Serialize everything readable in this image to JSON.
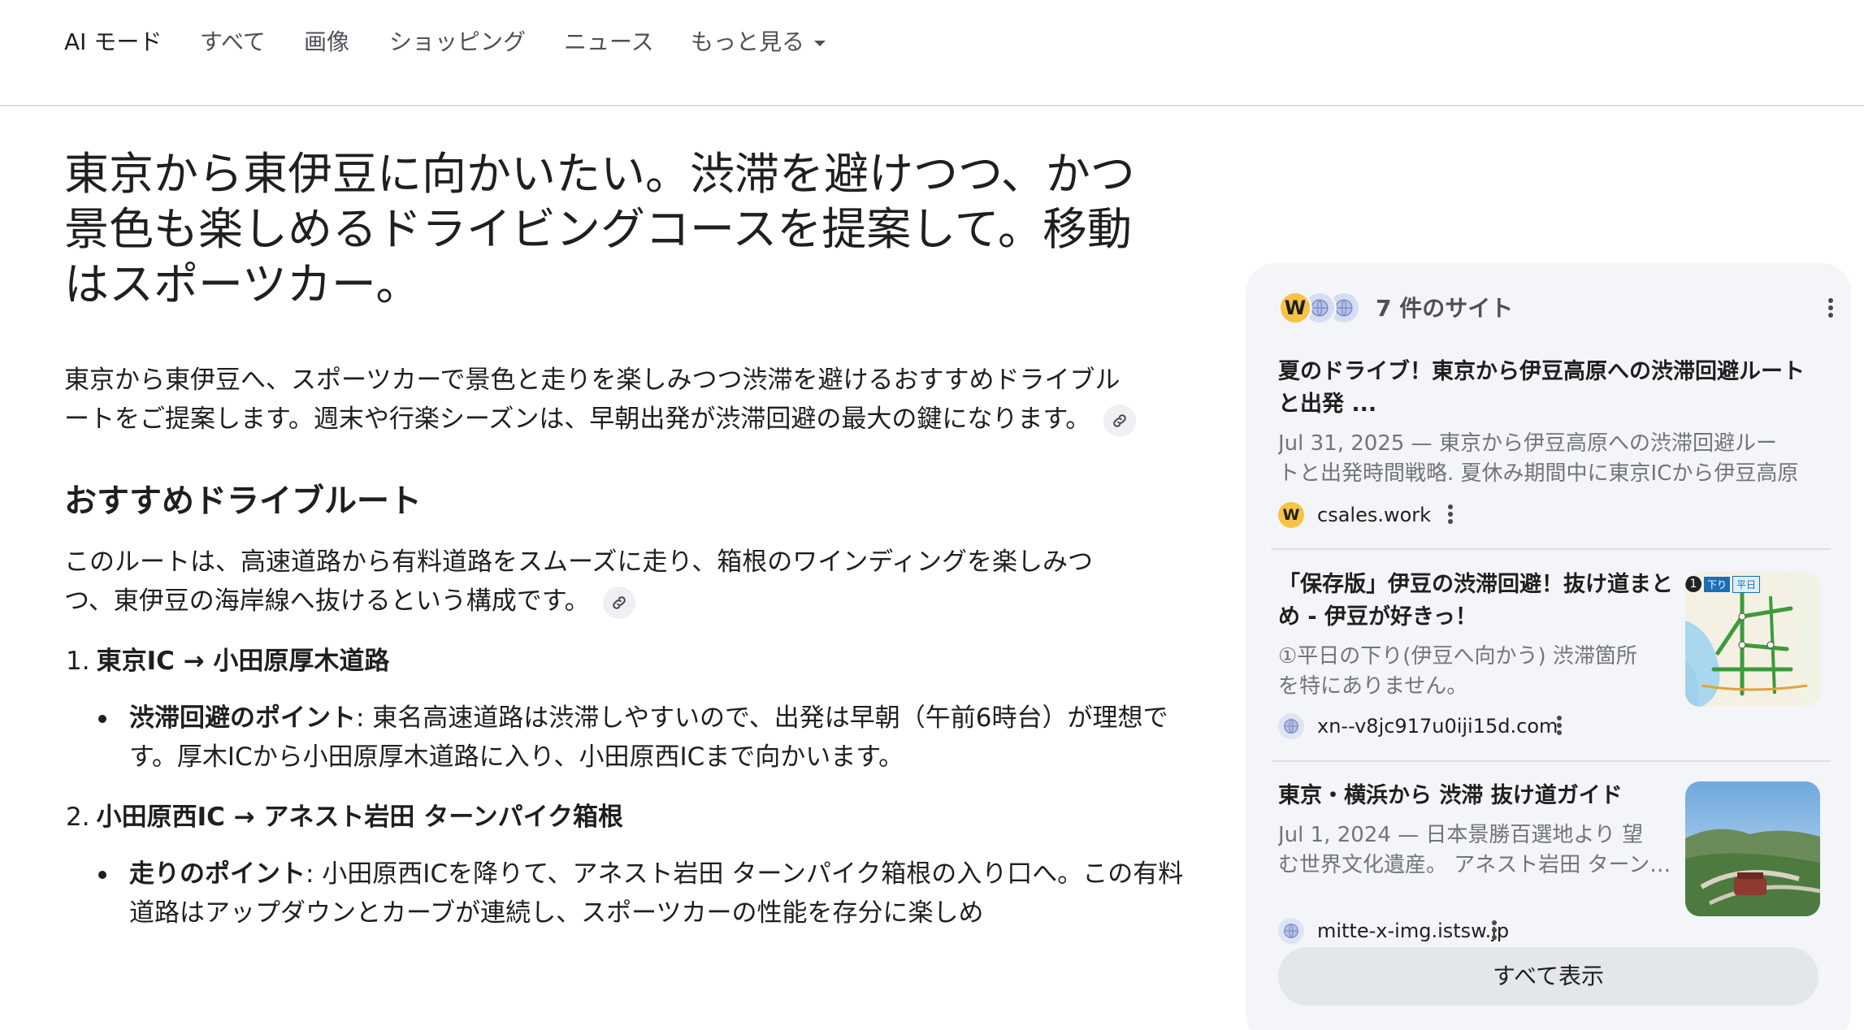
{
  "nav": {
    "items": [
      "AI モード",
      "すべて",
      "画像",
      "ショッピング",
      "ニュース",
      "もっと見る"
    ]
  },
  "main": {
    "query": "東京から東伊豆に向かいたい。渋滞を避けつつ、かつ景色も楽しめるドライビングコースを提案して。移動はスポーツカー。",
    "intro": "東京から東伊豆へ、スポーツカーで景色と走りを楽しみつつ渋滞を避けるおすすめドライブルートをご提案します。週末や行楽シーズンは、早朝出発が渋滞回避の最大の鍵になります。",
    "section_heading": "おすすめドライブルート",
    "section_text": "このルートは、高速道路から有料道路をスムーズに走り、箱根のワインディングを楽しみつつ、東伊豆の海岸線へ抜けるという構成です。",
    "steps": [
      {
        "num": "1.",
        "title": "東京IC → 小田原厚木道路",
        "point_label": "渋滞回避のポイント",
        "point_text": ": 東名高速道路は渋滞しやすいので、出発は早朝（午前6時台）が理想です。厚木ICから小田原厚木道路に入り、小田原西ICまで向かいます。"
      },
      {
        "num": "2.",
        "title": "小田原西IC → アネスト岩田 ターンパイク箱根",
        "point_label": "走りのポイント",
        "point_text": ": 小田原西ICを降りて、アネスト岩田 ターンパイク箱根の入り口へ。この有料道路はアップダウンとカーブが連続し、スポーツカーの性能を存分に楽しめ"
      }
    ]
  },
  "sources": {
    "header": "7 件のサイト",
    "items": [
      {
        "title": "夏のドライブ！東京から伊豆高原への渋滞回避ルートと出発 ...",
        "snippet_line1": "Jul 31, 2025 — 東京から伊豆高原への渋滞回避ルー",
        "snippet_line2": "トと出発時間戦略. 夏休み期間中に東京ICから伊豆高原",
        "site": "csales.work",
        "favicon_letter": "W"
      },
      {
        "title": "「保存版」伊豆の渋滞回避！抜け道まとめ - 伊豆が好きっ！",
        "snippet_line1": "①平日の下り(伊豆へ向かう) 渋滞箇所",
        "snippet_line2": "を特にありません。",
        "site": "xn--v8jc917u0iji15d.com",
        "thumb_label_num": "1",
        "thumb_label_1": "下り",
        "thumb_label_2": "平日"
      },
      {
        "title": "東京・横浜から 渋滞 抜け道ガイド",
        "snippet_line1": "Jul 1, 2024 — 日本景勝百選地より 望",
        "snippet_line2": "む世界文化遺産。 アネスト岩田 ターンパイク",
        "site": "mitte-x-img.istsw.jp"
      }
    ],
    "show_all": "すべて表示"
  },
  "colors": {
    "panel_bg": "#f3f5f8",
    "favicon_yellow": "#f6c343",
    "divider": "#dadce0"
  },
  "icons": [
    "link-icon",
    "more-vert-icon",
    "globe-icon",
    "chevron-down-icon"
  ]
}
